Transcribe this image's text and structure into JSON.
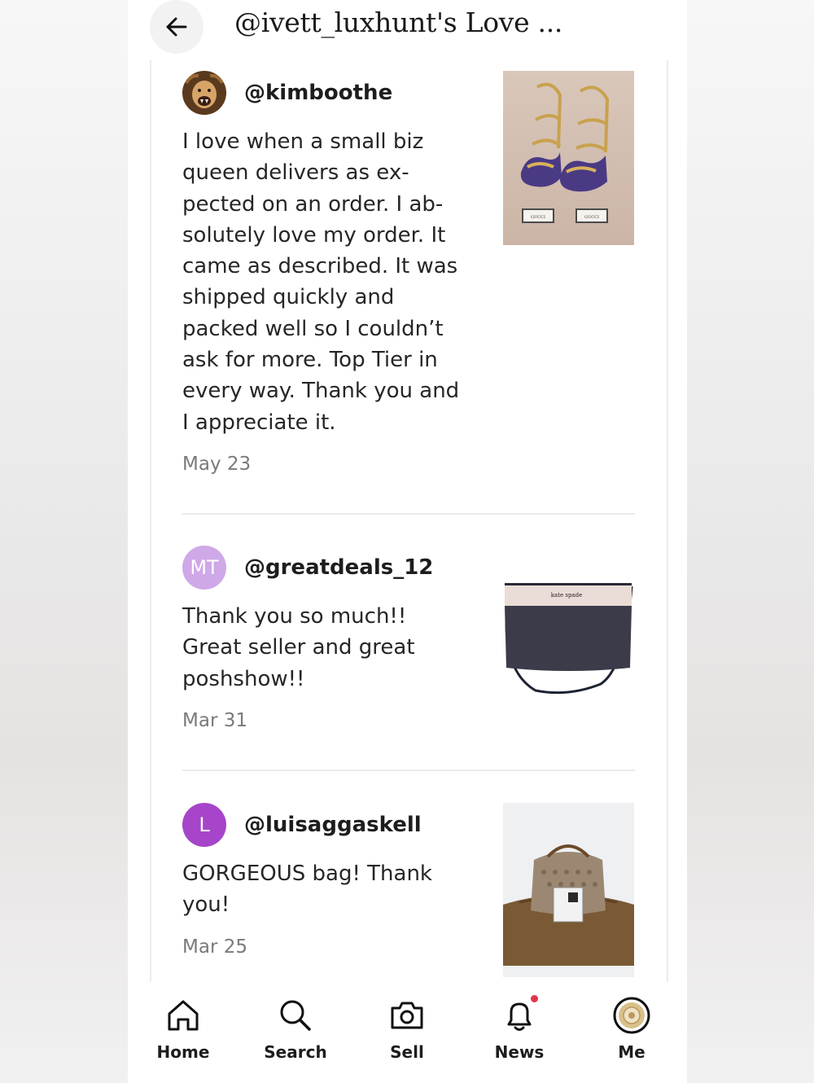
{
  "header": {
    "title": "@ivett_luxhunt's Love ..."
  },
  "reviews": [
    {
      "username": "@kimboothe",
      "avatar_letters": "",
      "avatar_color": "#8a5a2c",
      "text": "I love when a small biz\nqueen delivers as ex-\npected on an order. I ab-\nsolutely love my order. It\ncame as described. It was\nshipped quickly and\npacked well so I couldn’t\nask for more. Top Tier in\nevery way. Thank you and\nI appreciate it.",
      "date": "May 23",
      "image": "purple-gold-strappy-heels",
      "image_brand": "GUCCI"
    },
    {
      "username": "@greatdeals_12",
      "avatar_letters": "MT",
      "avatar_color": "#cfa8e8",
      "text": "Thank you so much!!\nGreat seller and great\nposhshow!!",
      "date": "Mar 31",
      "image": "kate-spade-crossbody-bag",
      "image_brand": "kate spade"
    },
    {
      "username": "@luisaggaskell",
      "avatar_letters": "L",
      "avatar_color": "#a645c9",
      "text": "GORGEOUS bag! Thank\nyou!",
      "date": "Mar 25",
      "image": "gucci-monogram-handbag",
      "image_brand": ""
    }
  ],
  "nav": {
    "items": [
      {
        "label": "Home",
        "icon": "home-icon"
      },
      {
        "label": "Search",
        "icon": "search-icon"
      },
      {
        "label": "Sell",
        "icon": "camera-icon"
      },
      {
        "label": "News",
        "icon": "bell-icon",
        "has_notification": true
      },
      {
        "label": "Me",
        "icon": "profile-avatar"
      }
    ]
  },
  "colors": {
    "notification_dot": "#e5334b",
    "date_text": "#7a7a7a",
    "divider": "#eaeaea"
  }
}
